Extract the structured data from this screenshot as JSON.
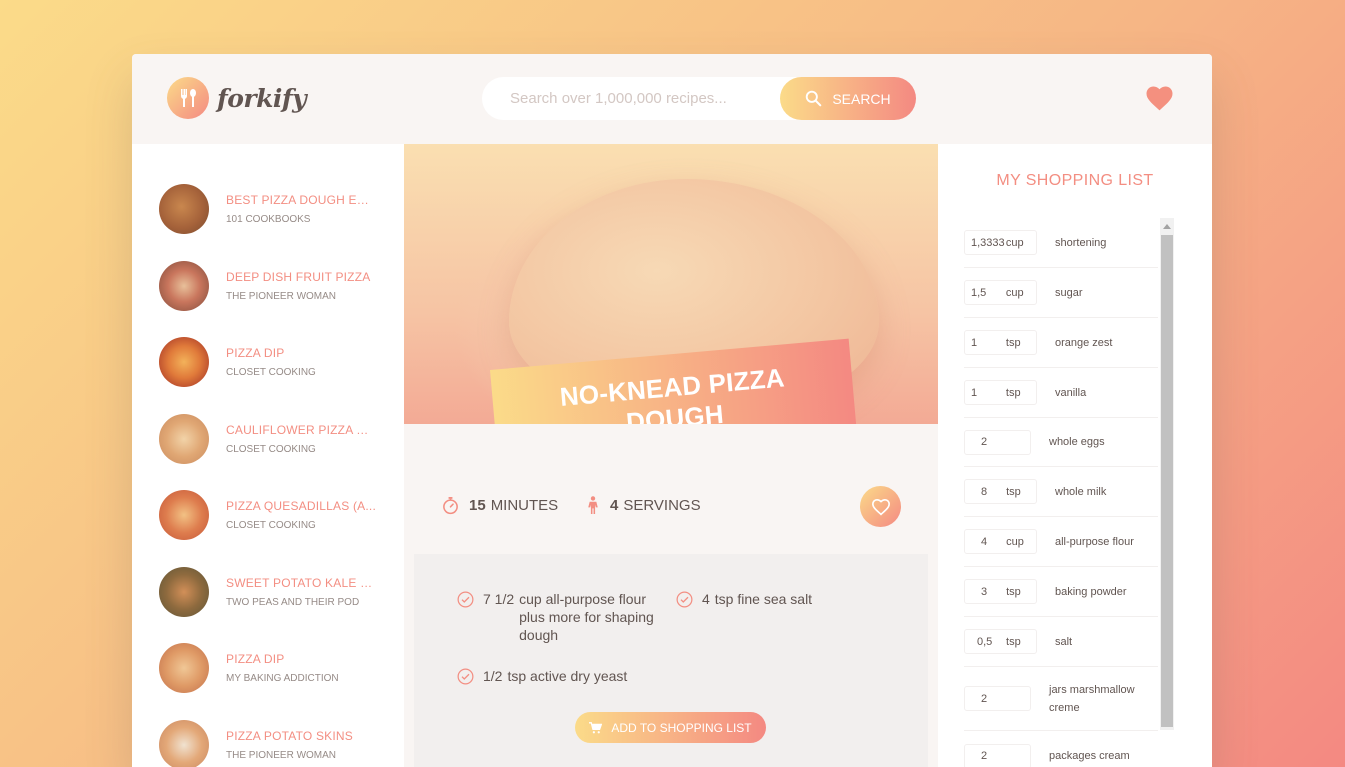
{
  "app": {
    "name": "forkify"
  },
  "search": {
    "placeholder": "Search over 1,000,000 recipes...",
    "button_label": "SEARCH"
  },
  "results": [
    {
      "title": "BEST PIZZA DOUGH EVER",
      "author": "101 COOKBOOKS"
    },
    {
      "title": "DEEP DISH FRUIT PIZZA",
      "author": "THE PIONEER WOMAN"
    },
    {
      "title": "PIZZA DIP",
      "author": "CLOSET COOKING"
    },
    {
      "title": "CAULIFLOWER PIZZA CR...",
      "author": "CLOSET COOKING"
    },
    {
      "title": "PIZZA QUESADILLAS (A...",
      "author": "CLOSET COOKING"
    },
    {
      "title": "SWEET POTATO KALE PI...",
      "author": "TWO PEAS AND THEIR POD"
    },
    {
      "title": "PIZZA DIP",
      "author": "MY BAKING ADDICTION"
    },
    {
      "title": "PIZZA POTATO SKINS",
      "author": "THE PIONEER WOMAN"
    }
  ],
  "recipe": {
    "title": "NO-KNEAD PIZZA DOUGH",
    "minutes": "15",
    "minutes_label": "MINUTES",
    "servings": "4",
    "servings_label": "SERVINGS",
    "ingredients": [
      {
        "count": "7 1/2",
        "desc": "cup all-purpose flour plus more for shaping dough"
      },
      {
        "count": "4",
        "desc": "tsp fine sea salt"
      },
      {
        "count": "1/2",
        "desc": "tsp active dry yeast"
      }
    ],
    "add_button_label": "ADD TO SHOPPING LIST"
  },
  "shopping": {
    "heading": "MY SHOPPING LIST",
    "items": [
      {
        "count": "1,3333",
        "unit": "cup",
        "desc": "shortening"
      },
      {
        "count": "1,5",
        "unit": "cup",
        "desc": "sugar"
      },
      {
        "count": "1",
        "unit": "tsp",
        "desc": "orange zest"
      },
      {
        "count": "1",
        "unit": "tsp",
        "desc": "vanilla"
      },
      {
        "count": "2",
        "unit": "",
        "desc": "whole eggs"
      },
      {
        "count": "8",
        "unit": "tsp",
        "desc": "whole milk"
      },
      {
        "count": "4",
        "unit": "cup",
        "desc": "all-purpose flour"
      },
      {
        "count": "3",
        "unit": "tsp",
        "desc": "baking powder"
      },
      {
        "count": "0,5",
        "unit": "tsp",
        "desc": "salt"
      },
      {
        "count": "2",
        "unit": "",
        "desc": "jars marshmallow creme"
      },
      {
        "count": "2",
        "unit": "",
        "desc": "packages cream"
      }
    ]
  },
  "colors": {
    "primary_light": "#fbdb89",
    "primary_dark": "#f48982",
    "accent_text": "#f38e82",
    "text": "#615551"
  },
  "icons": {
    "logo": "fork-spoon-icon",
    "search": "search-icon",
    "likes": "heart-icon",
    "timer": "stopwatch-icon",
    "servings": "person-icon",
    "like": "heart-outline-icon",
    "check": "check-circle-icon",
    "cart": "cart-icon"
  }
}
